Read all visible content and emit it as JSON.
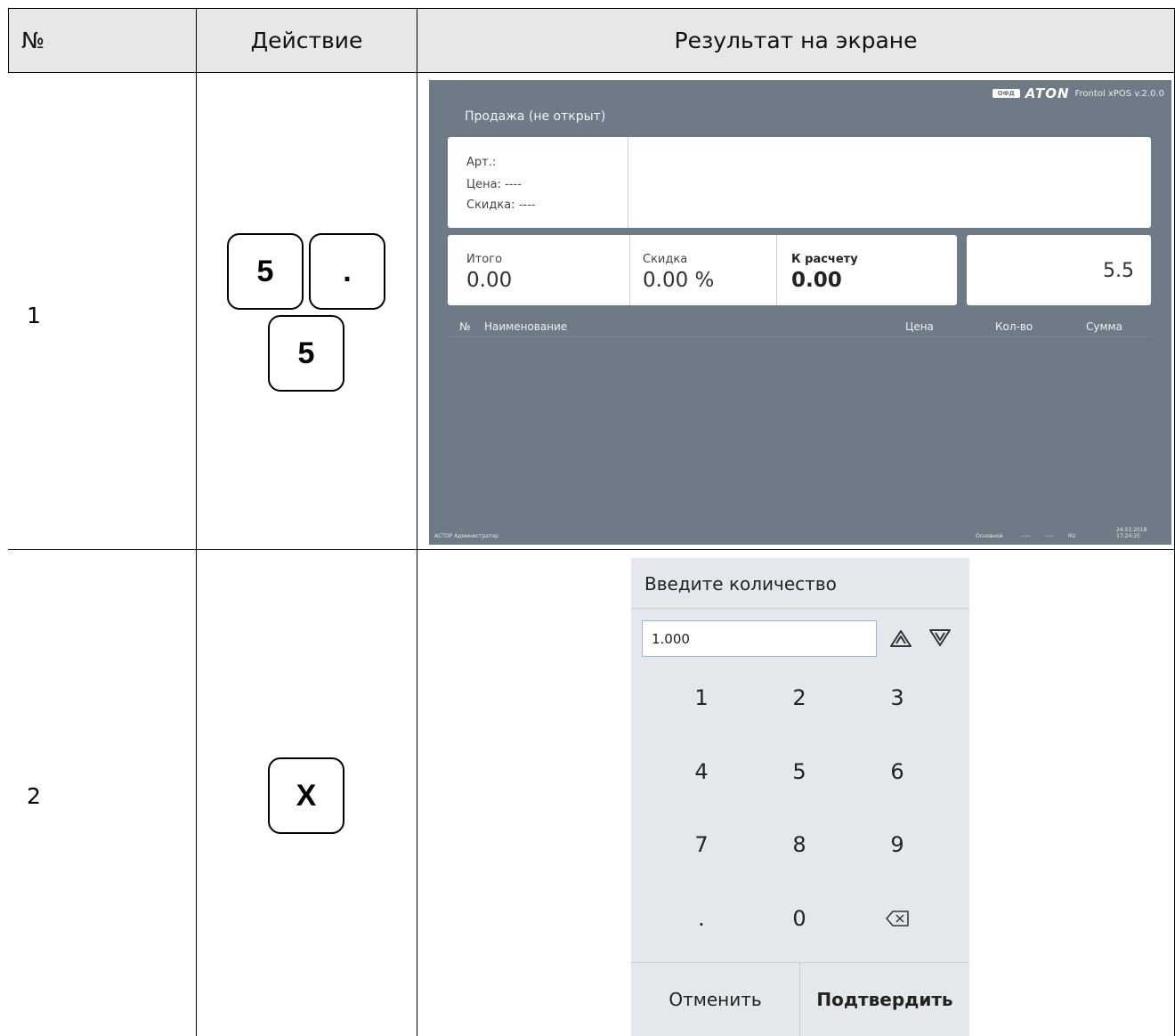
{
  "table": {
    "headers": {
      "num": "№",
      "action": "Действие",
      "result": "Результат на экране"
    },
    "rows": [
      {
        "num": "1",
        "keys": [
          "5",
          ".",
          "5"
        ]
      },
      {
        "num": "2",
        "keys": [
          "X"
        ]
      }
    ]
  },
  "pos_screen": {
    "brand": {
      "ofd": "ОФД",
      "logo": "ATON",
      "version": "Frontol xPOS v.2.0.0"
    },
    "mode": "Продажа (не открыт)",
    "info": {
      "art": "Арт.:",
      "price": "Цена:  ----",
      "discount": "Скидка:   ----"
    },
    "totals": {
      "total_label": "Итого",
      "total_value": "0.00",
      "discount_label": "Скидка",
      "discount_value": "0.00 %",
      "pay_label": "К расчету",
      "pay_value": "0.00"
    },
    "entry": "5.5",
    "columns": {
      "num": "№",
      "name": "Наименование",
      "price": "Цена",
      "qty": "Кол-во",
      "sum": "Сумма"
    },
    "footer": {
      "left": "АСТОР  Администратор",
      "profile": "Основной",
      "f1": "--:--",
      "f2": "--:--",
      "lang": "RU",
      "datetime": "24.03.2018 17:24:25"
    }
  },
  "dialog": {
    "title": "Введите количество",
    "input_value": "1.000",
    "keys": [
      "1",
      "2",
      "3",
      "4",
      "5",
      "6",
      "7",
      "8",
      "9",
      ".",
      "0"
    ],
    "cancel": "Отменить",
    "confirm": "Подтвердить",
    "icons": {
      "up": "triangle-up-icon",
      "down": "triangle-down-icon",
      "backspace": "backspace-icon"
    }
  }
}
